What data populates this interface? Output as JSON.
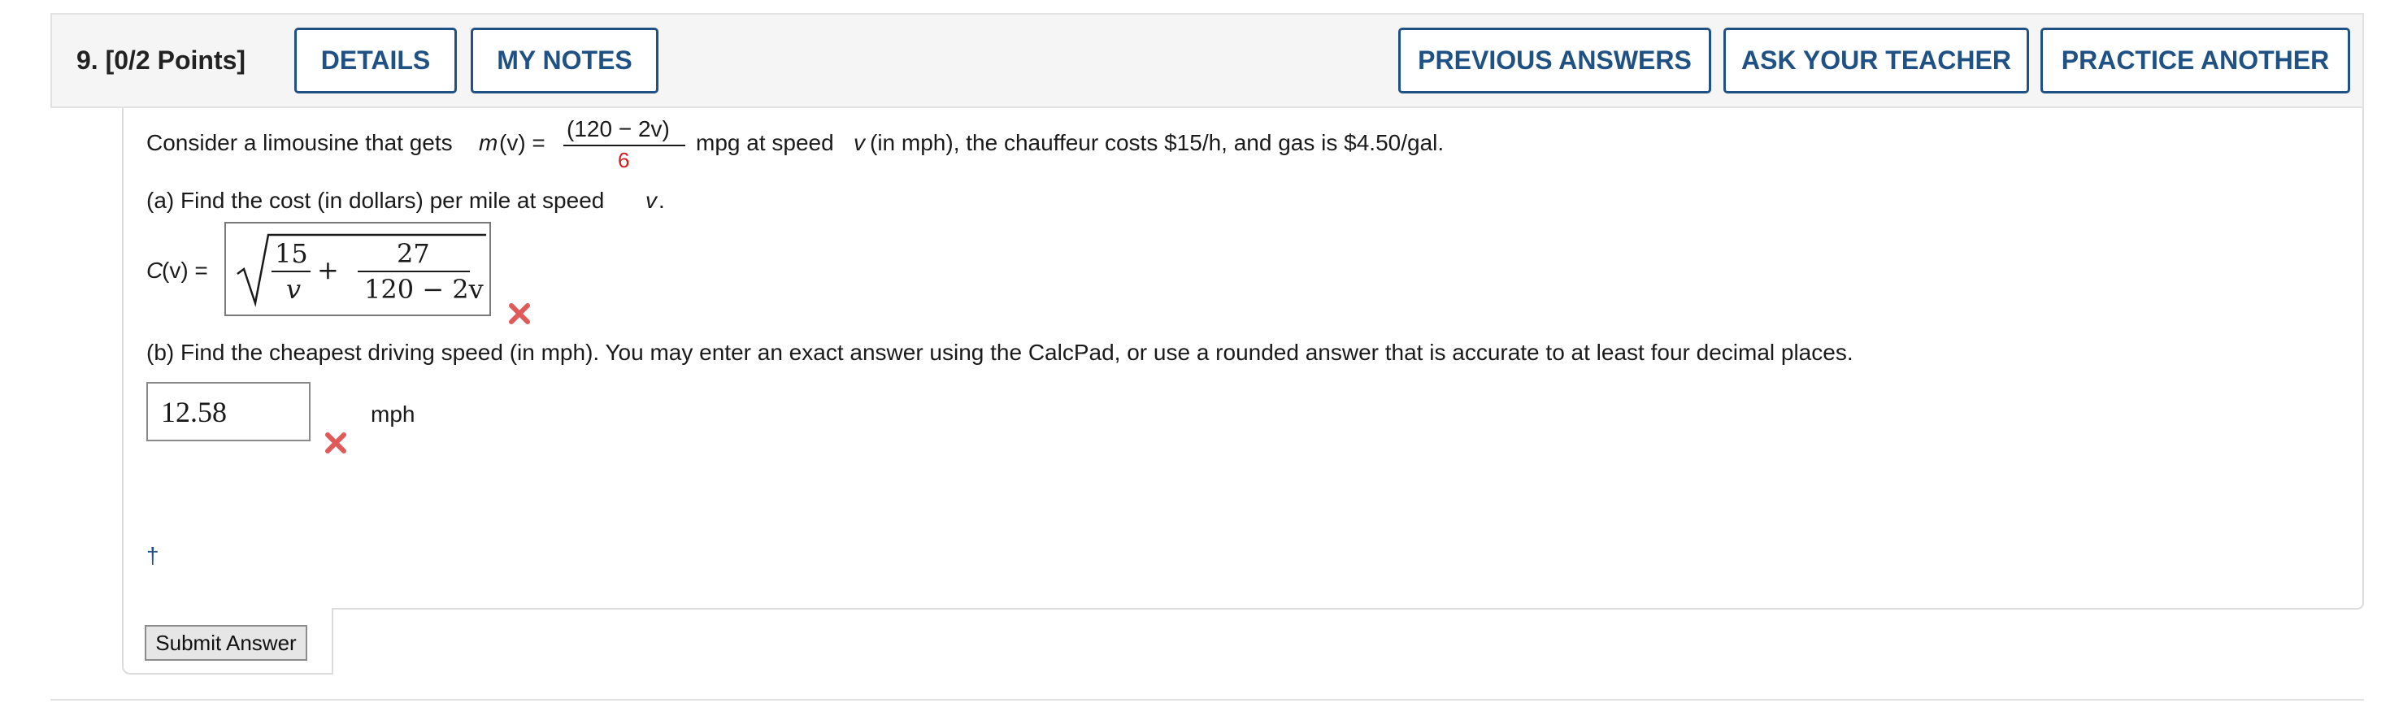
{
  "header": {
    "question_number": "9.",
    "points": "[0/2 Points]",
    "buttons": {
      "details": "DETAILS",
      "my_notes": "MY NOTES",
      "previous_answers": "PREVIOUS ANSWERS",
      "ask_teacher": "ASK YOUR TEACHER",
      "practice_another": "PRACTICE ANOTHER"
    }
  },
  "problem": {
    "intro_prefix": "Consider a limousine that gets",
    "m_of_v": "m",
    "paren_v_eq": "(v) =",
    "frac_numerator": "(120 − 2v)",
    "frac_denominator": "6",
    "intro_mid": "mpg at speed",
    "var_v": "v",
    "intro_suffix": "(in mph), the chauffeur costs $15/h, and gas is $4.50/gal."
  },
  "part_a": {
    "question_prefix": "(a) Find the cost (in dollars) per mile at speed",
    "question_var": "v",
    "question_end": ".",
    "label_c": "C",
    "label_rest": "(v) =",
    "answer": {
      "term1_num": "15",
      "term1_den": "v",
      "plus": "+",
      "term2_num": "27",
      "term2_den": "120 − 2v"
    },
    "status": "incorrect"
  },
  "part_b": {
    "question": "(b) Find the cheapest driving speed (in mph). You may enter an exact answer using the CalcPad, or use a rounded answer that is accurate to at least four decimal places.",
    "answer_value": "12.58",
    "unit": "mph",
    "status": "incorrect"
  },
  "footnote_marker": "†",
  "submit_label": "Submit Answer",
  "colors": {
    "accent": "#1f5185",
    "incorrect": "#e05a5a",
    "denominator_red": "#d21f1f"
  }
}
